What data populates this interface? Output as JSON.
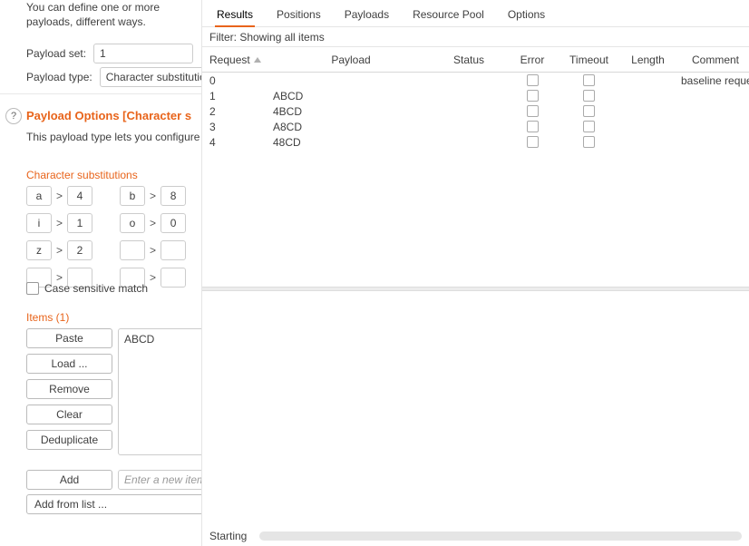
{
  "left": {
    "intro_text": "You can define one or more payloads, different ways.",
    "payload_set_label": "Payload set:",
    "payload_set_value": "1",
    "payload_type_label": "Payload type:",
    "payload_type_value": "Character substitution",
    "help_symbol": "?",
    "section_title": "Payload Options [Character s",
    "section_desc": "This payload type lets you configure",
    "char_sub_title": "Character substitutions",
    "subs": [
      {
        "from": "a",
        "to": "4"
      },
      {
        "from": "b",
        "to": "8"
      },
      {
        "from": "i",
        "to": "1"
      },
      {
        "from": "o",
        "to": "0"
      },
      {
        "from": "z",
        "to": "2"
      },
      {
        "from": "",
        "to": ""
      },
      {
        "from": "",
        "to": ""
      },
      {
        "from": "",
        "to": ""
      }
    ],
    "gt": ">",
    "case_sensitive_label": "Case sensitive match",
    "items_title": "Items (1)",
    "buttons": {
      "paste": "Paste",
      "load": "Load ...",
      "remove": "Remove",
      "clear": "Clear",
      "dedup": "Deduplicate",
      "add": "Add",
      "add_from_list": "Add from list ..."
    },
    "items": [
      "ABCD"
    ],
    "new_item_placeholder": "Enter a new item"
  },
  "right": {
    "tabs": [
      "Results",
      "Positions",
      "Payloads",
      "Resource Pool",
      "Options"
    ],
    "active_tab": 0,
    "filter_text": "Filter: Showing all items",
    "columns": [
      "Request",
      "Payload",
      "Status",
      "Error",
      "Timeout",
      "Length",
      "Comment"
    ],
    "rows": [
      {
        "request": "0",
        "payload": "",
        "status": "",
        "error": false,
        "timeout": false,
        "length": "",
        "comment": "baseline request"
      },
      {
        "request": "1",
        "payload": "ABCD",
        "status": "",
        "error": false,
        "timeout": false,
        "length": "",
        "comment": ""
      },
      {
        "request": "2",
        "payload": "4BCD",
        "status": "",
        "error": false,
        "timeout": false,
        "length": "",
        "comment": ""
      },
      {
        "request": "3",
        "payload": "A8CD",
        "status": "",
        "error": false,
        "timeout": false,
        "length": "",
        "comment": ""
      },
      {
        "request": "4",
        "payload": "48CD",
        "status": "",
        "error": false,
        "timeout": false,
        "length": "",
        "comment": ""
      }
    ],
    "status_text": "Starting"
  }
}
